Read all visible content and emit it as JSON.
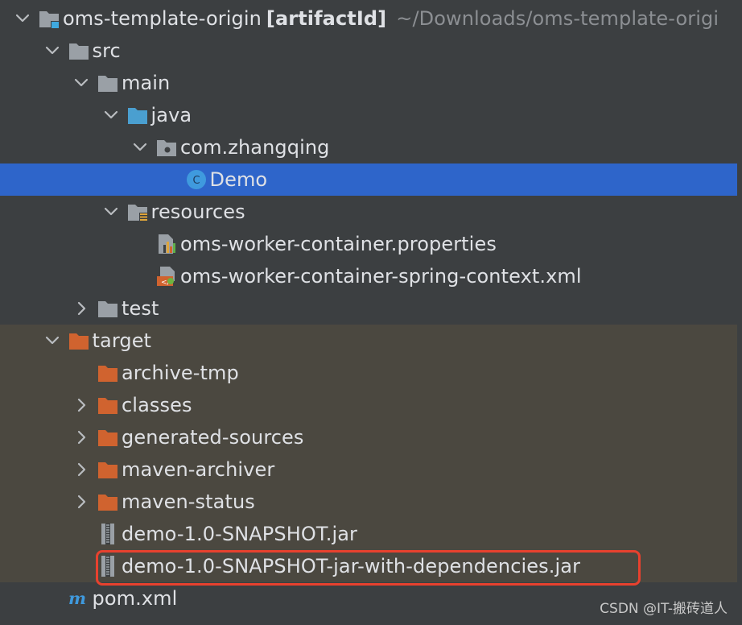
{
  "colors": {
    "background": "#3c3f41",
    "target_background": "#4b4840",
    "selection": "#2e65ca",
    "highlight_border": "#e8412e",
    "folder_grey": "#9aa0a6",
    "folder_blue": "#4a9fd0",
    "folder_orange": "#d0632f",
    "class_icon": "#3f9ade"
  },
  "tree": [
    {
      "id": "root",
      "label": "oms-template-origin",
      "suffix": "[artifactId]",
      "path": "~/Downloads/oms-template-origi",
      "depth": 0,
      "expanded": true,
      "icon": "module-folder-icon",
      "zone": "normal"
    },
    {
      "id": "src",
      "label": "src",
      "depth": 1,
      "expanded": true,
      "icon": "folder-icon",
      "zone": "normal"
    },
    {
      "id": "main",
      "label": "main",
      "depth": 2,
      "expanded": true,
      "icon": "folder-icon",
      "zone": "normal"
    },
    {
      "id": "java",
      "label": "java",
      "depth": 3,
      "expanded": true,
      "icon": "source-folder-icon",
      "zone": "normal"
    },
    {
      "id": "pkg",
      "label": "com.zhangqing",
      "depth": 4,
      "expanded": true,
      "icon": "package-icon",
      "zone": "normal"
    },
    {
      "id": "demo",
      "label": "Demo",
      "depth": 5,
      "leaf": true,
      "icon": "java-class-icon",
      "zone": "normal",
      "selected": true
    },
    {
      "id": "resources",
      "label": "resources",
      "depth": 3,
      "expanded": true,
      "icon": "resources-folder-icon",
      "zone": "normal"
    },
    {
      "id": "props",
      "label": "oms-worker-container.properties",
      "depth": 4,
      "leaf": true,
      "icon": "properties-file-icon",
      "zone": "normal"
    },
    {
      "id": "xml",
      "label": "oms-worker-container-spring-context.xml",
      "depth": 4,
      "leaf": true,
      "icon": "spring-xml-file-icon",
      "zone": "normal"
    },
    {
      "id": "test",
      "label": "test",
      "depth": 2,
      "expanded": false,
      "icon": "folder-icon",
      "zone": "normal"
    },
    {
      "id": "target",
      "label": "target",
      "depth": 1,
      "expanded": true,
      "icon": "excluded-folder-icon",
      "zone": "target"
    },
    {
      "id": "archive",
      "label": "archive-tmp",
      "depth": 2,
      "leaf": true,
      "icon": "excluded-folder-icon",
      "zone": "target"
    },
    {
      "id": "classes",
      "label": "classes",
      "depth": 2,
      "expanded": false,
      "icon": "excluded-folder-icon",
      "zone": "target"
    },
    {
      "id": "gensrc",
      "label": "generated-sources",
      "depth": 2,
      "expanded": false,
      "icon": "excluded-folder-icon",
      "zone": "target"
    },
    {
      "id": "mvnarch",
      "label": "maven-archiver",
      "depth": 2,
      "expanded": false,
      "icon": "excluded-folder-icon",
      "zone": "target"
    },
    {
      "id": "mvnstat",
      "label": "maven-status",
      "depth": 2,
      "expanded": false,
      "icon": "excluded-folder-icon",
      "zone": "target"
    },
    {
      "id": "jar1",
      "label": "demo-1.0-SNAPSHOT.jar",
      "depth": 2,
      "leaf": true,
      "icon": "jar-file-icon",
      "zone": "target"
    },
    {
      "id": "jar2",
      "label": "demo-1.0-SNAPSHOT-jar-with-dependencies.jar",
      "depth": 2,
      "leaf": true,
      "icon": "jar-file-icon",
      "zone": "target",
      "highlighted": true
    },
    {
      "id": "pom",
      "label": "pom.xml",
      "depth": 1,
      "leaf": true,
      "icon": "maven-pom-icon",
      "zone": "normal"
    }
  ],
  "watermark": "CSDN @IT-搬砖道人"
}
